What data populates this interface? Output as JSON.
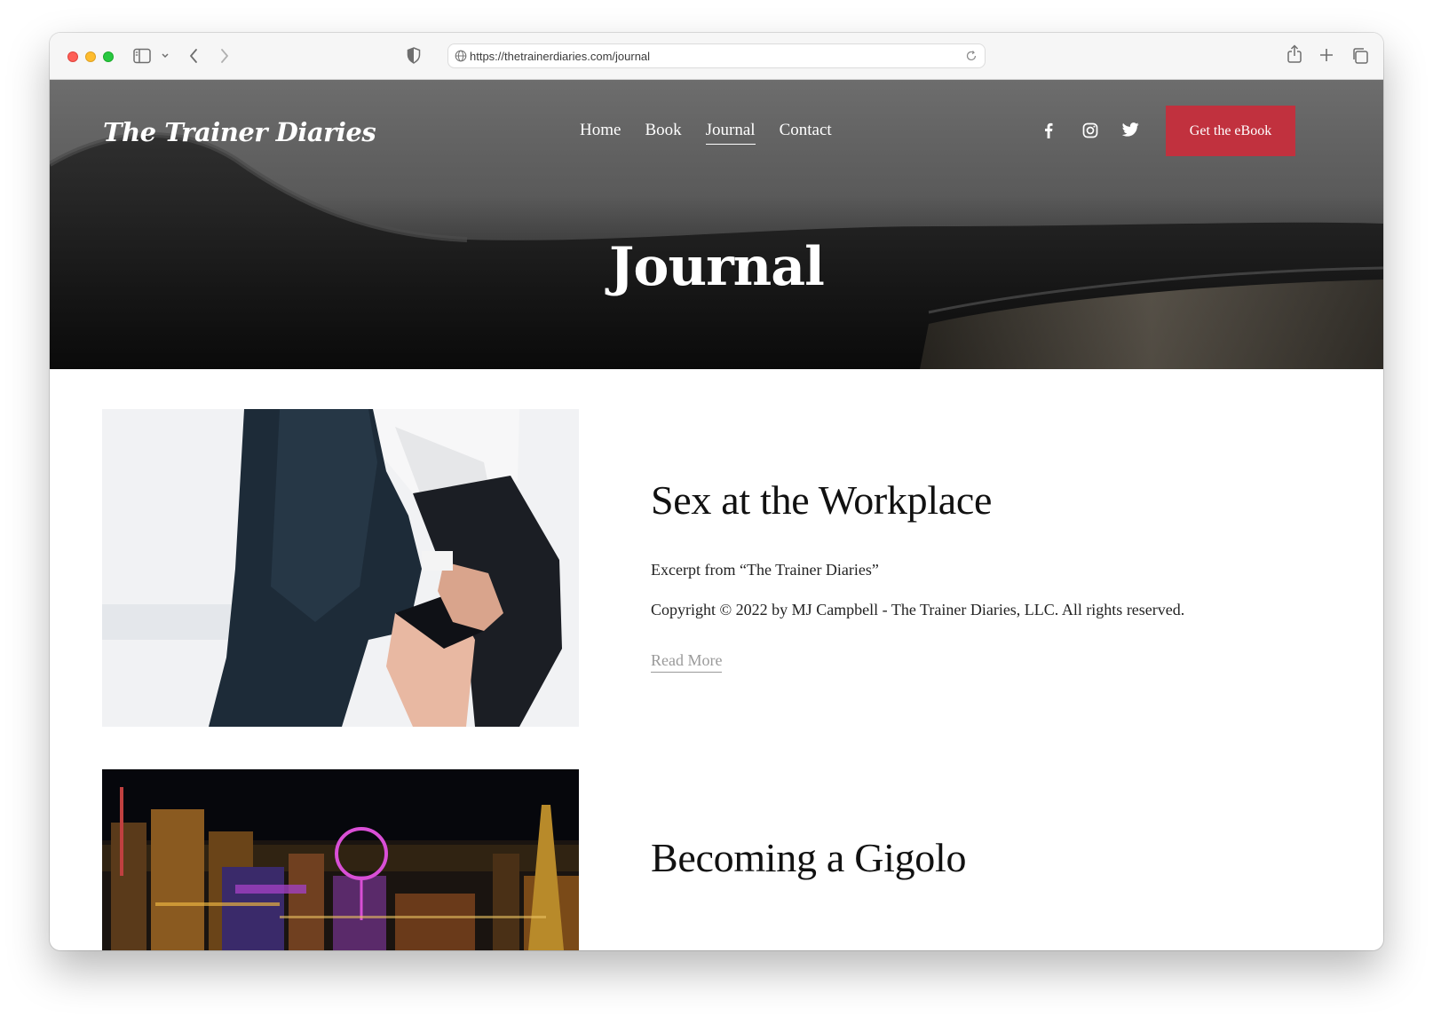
{
  "browser": {
    "url": "https://thetrainerdiaries.com/journal",
    "icons": [
      "sidebar-icon",
      "chevron-down-icon",
      "back-icon",
      "forward-icon",
      "shield-icon",
      "globe-icon",
      "reload-icon",
      "share-icon",
      "new-tab-icon",
      "tabs-overview-icon"
    ]
  },
  "site": {
    "logo": "The Trainer Diaries",
    "nav": [
      {
        "label": "Home",
        "active": false
      },
      {
        "label": "Book",
        "active": false
      },
      {
        "label": "Journal",
        "active": true
      },
      {
        "label": "Contact",
        "active": false
      }
    ],
    "social_icons": [
      "facebook-icon",
      "instagram-icon",
      "twitter-icon"
    ],
    "cta_label": "Get the eBook",
    "cta_color": "#c1313e"
  },
  "hero": {
    "title": "Journal"
  },
  "posts": [
    {
      "title": "Sex at the Workplace",
      "excerpt_lines": [
        "Excerpt from “The Trainer Diaries”",
        "Copyright © 2022 by MJ Campbell - The Trainer Diaries, LLC. All rights reserved."
      ],
      "read_more": "Read More"
    },
    {
      "title": "Becoming a Gigolo"
    }
  ]
}
